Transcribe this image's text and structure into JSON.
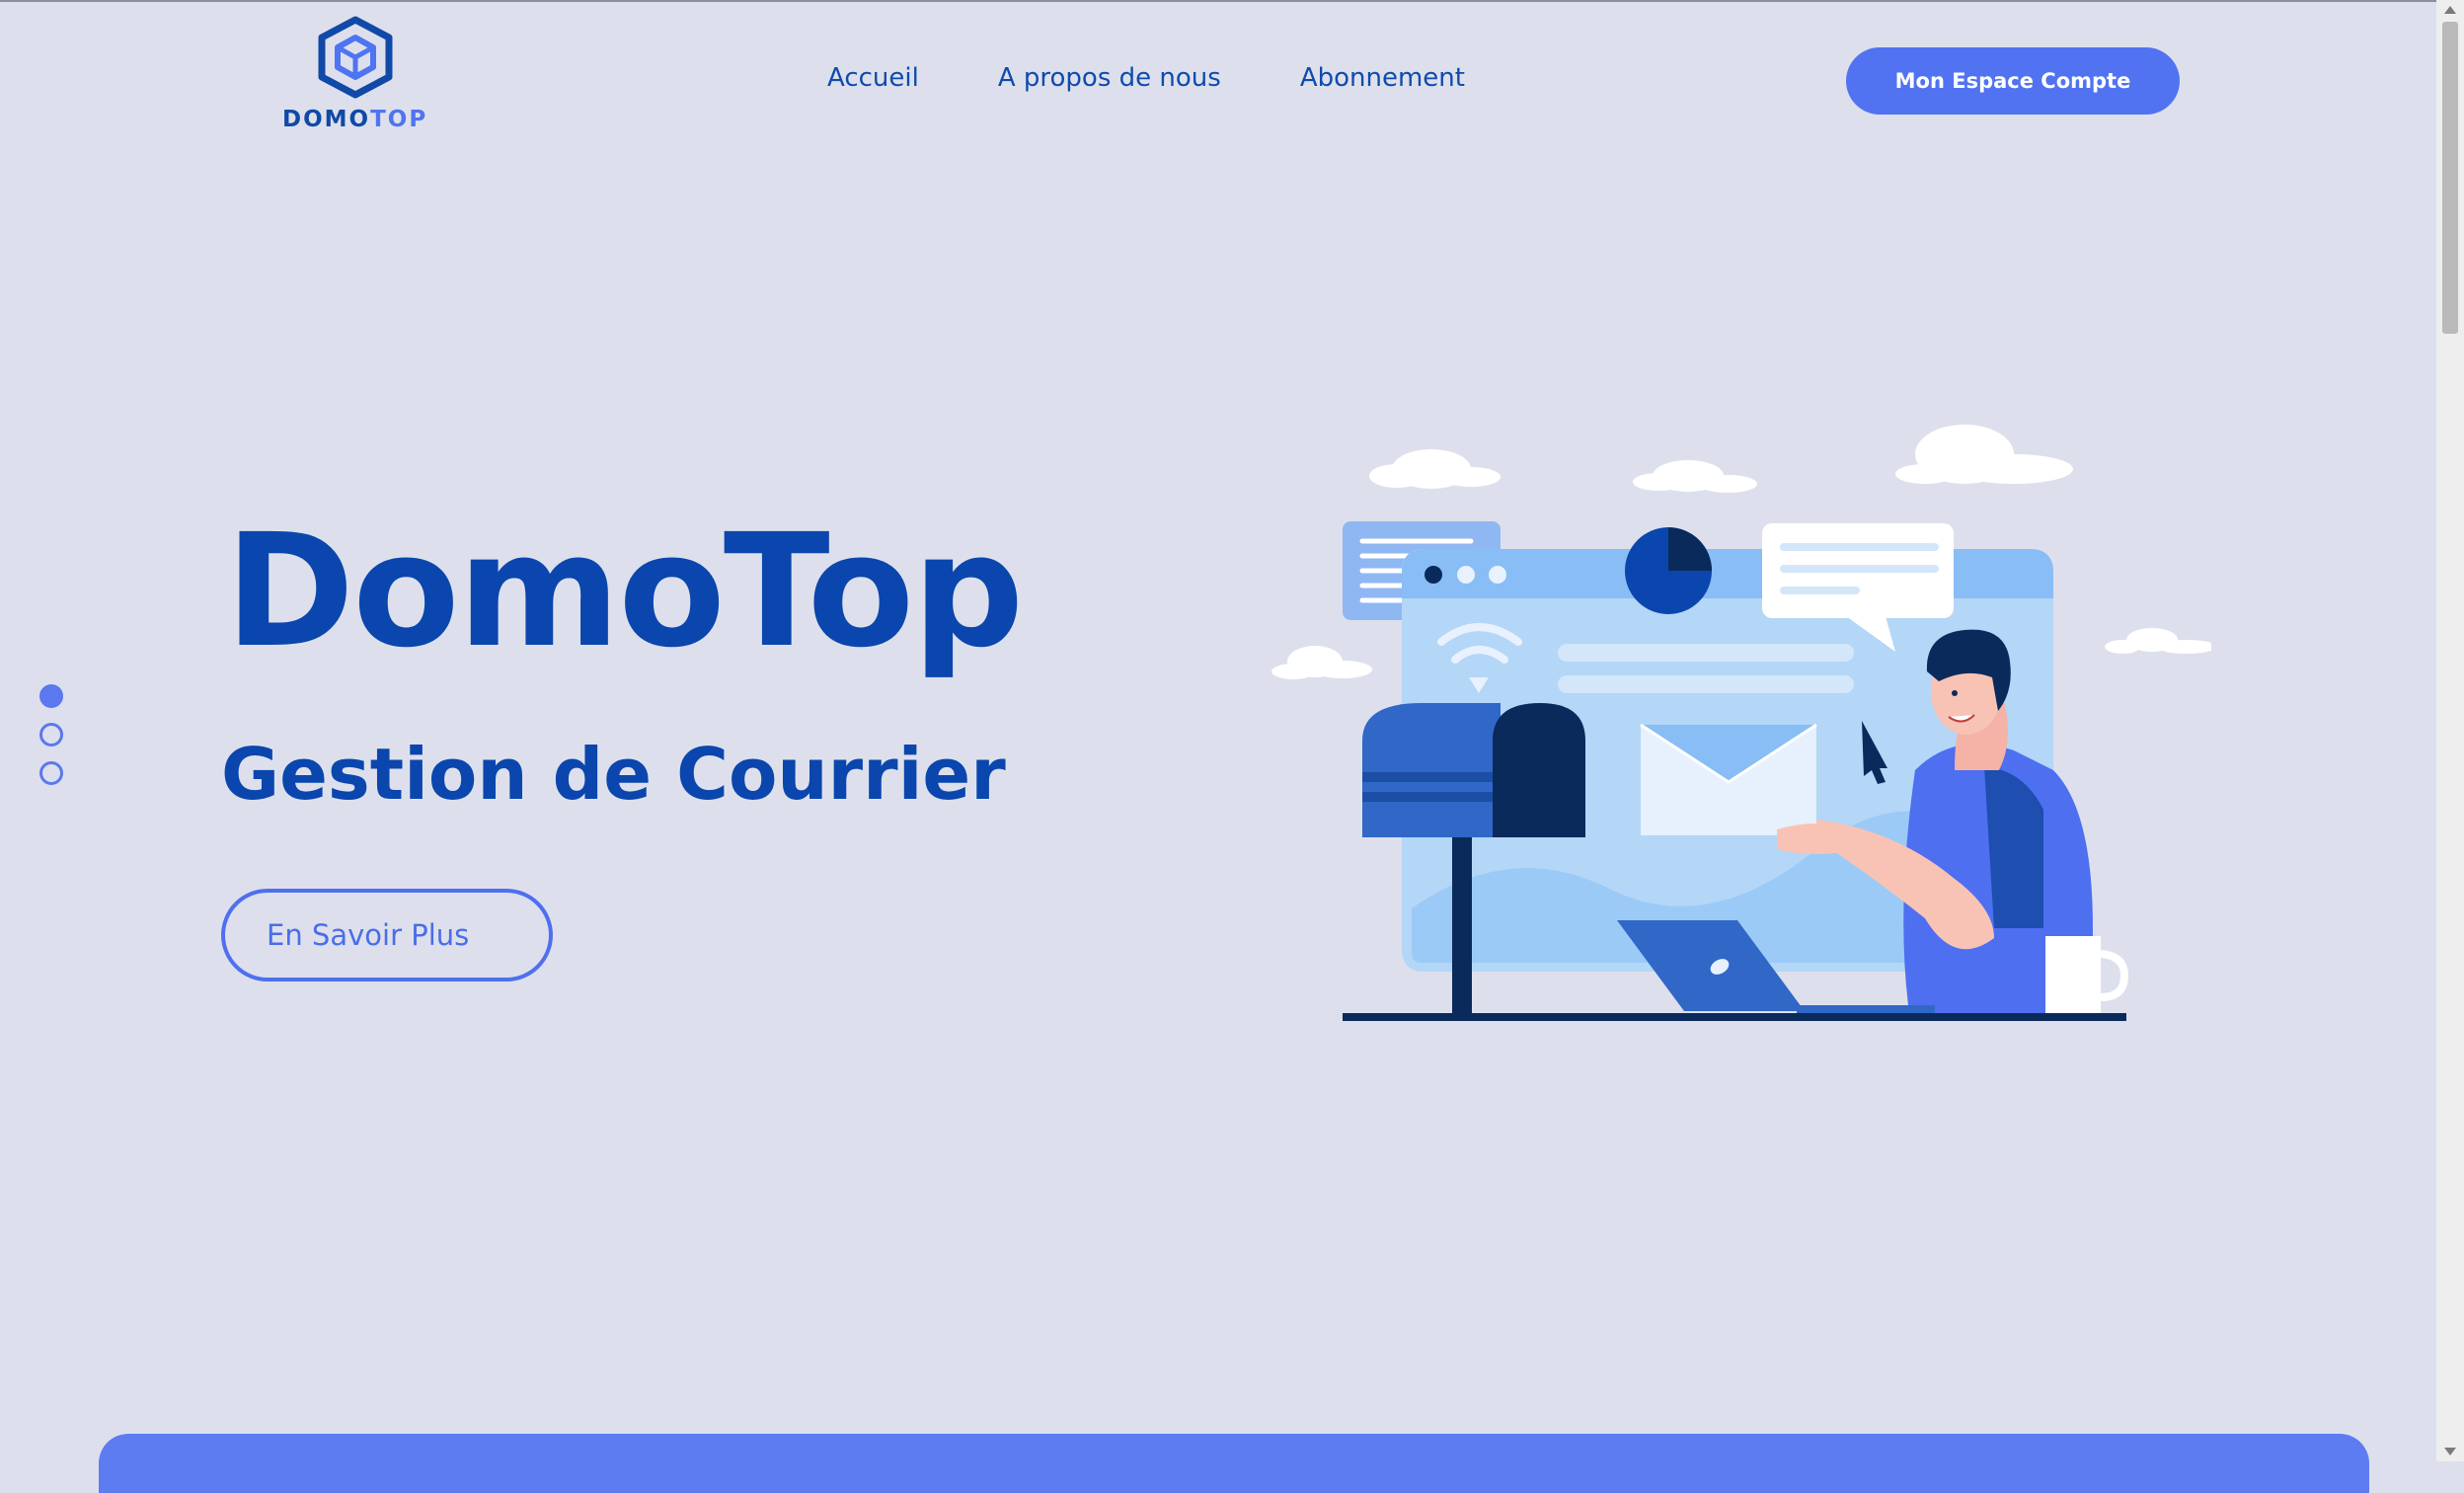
{
  "brand": {
    "logo_part1": "DOMO",
    "logo_part2": "TOP"
  },
  "nav": {
    "items": [
      {
        "label": "Accueil"
      },
      {
        "label": "A propos de nous"
      },
      {
        "label": "Abonnement"
      }
    ]
  },
  "header": {
    "account_button": "Mon Espace Compte"
  },
  "hero": {
    "title": "DomoTop",
    "subtitle": "Gestion de Courrier",
    "cta": "En Savoir Plus"
  },
  "slider": {
    "count": 3,
    "active_index": 0
  },
  "colors": {
    "background": "#dde0ec",
    "primary": "#0a46ad",
    "accent": "#5173f2",
    "illustration_light": "#b4d6f7",
    "illustration_dark": "#0a2a5c"
  },
  "icons": [
    "logo-cube-icon",
    "envelope-icon",
    "wifi-icon",
    "cursor-icon",
    "mailbox-icon",
    "laptop-icon",
    "mug-icon"
  ]
}
